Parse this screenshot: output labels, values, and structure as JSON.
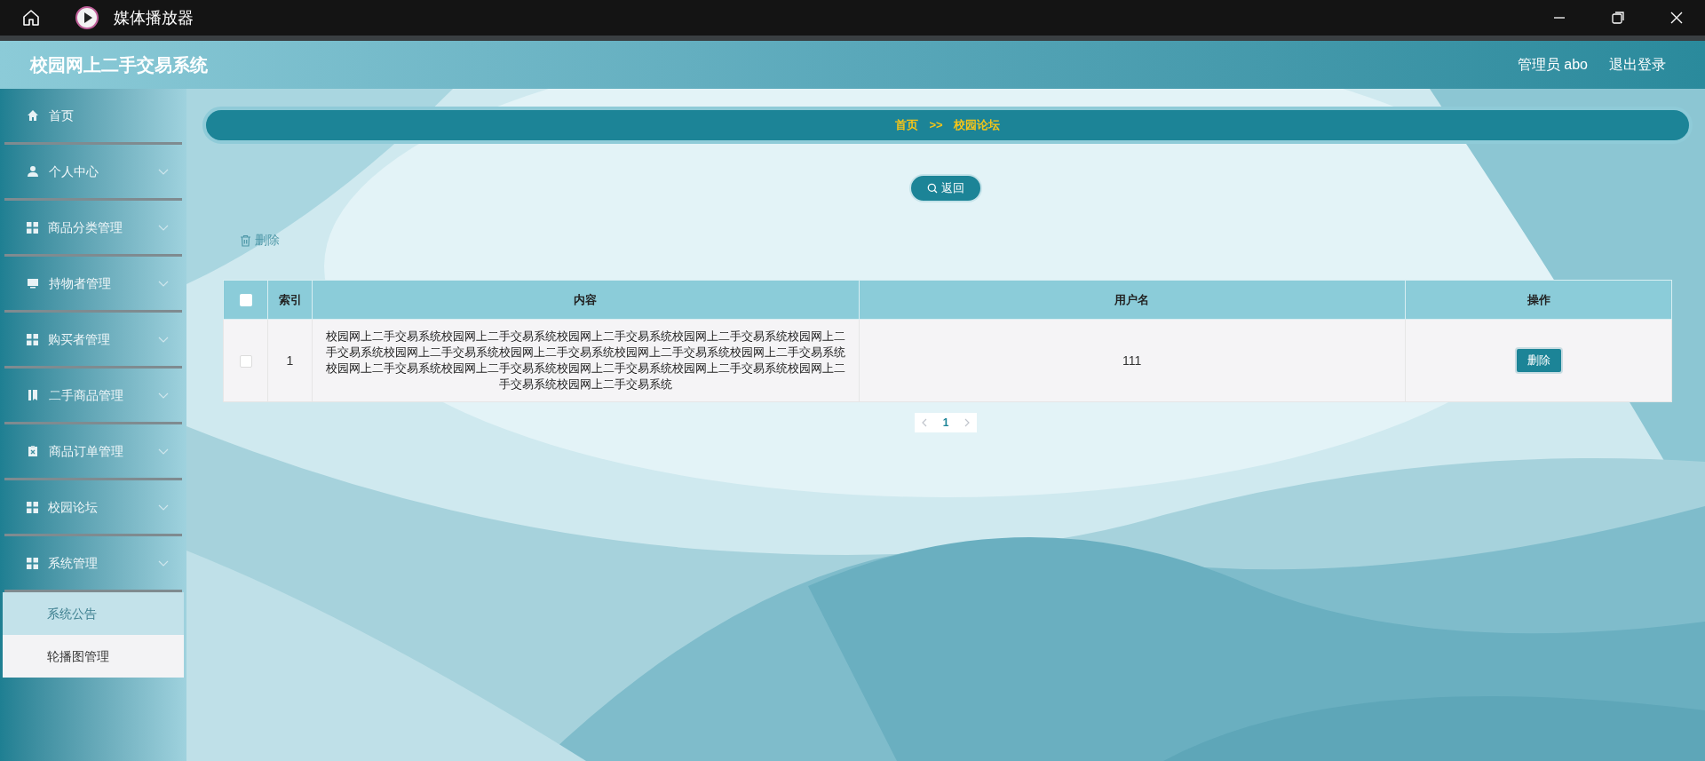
{
  "window": {
    "title": "媒体播放器"
  },
  "header": {
    "title": "校园网上二手交易系统",
    "user": "管理员 abo",
    "logout": "退出登录"
  },
  "sidebar": {
    "items": [
      {
        "label": "首页",
        "has_children": false
      },
      {
        "label": "个人中心",
        "has_children": true
      },
      {
        "label": "商品分类管理",
        "has_children": true
      },
      {
        "label": "持物者管理",
        "has_children": true
      },
      {
        "label": "购买者管理",
        "has_children": true
      },
      {
        "label": "二手商品管理",
        "has_children": true
      },
      {
        "label": "商品订单管理",
        "has_children": true
      },
      {
        "label": "校园论坛",
        "has_children": true
      },
      {
        "label": "系统管理",
        "has_children": true,
        "children": [
          {
            "label": "系统公告",
            "selected": true
          },
          {
            "label": "轮播图管理",
            "selected": false
          }
        ]
      }
    ]
  },
  "breadcrumb": {
    "home": "首页",
    "separator": ">>",
    "current": "校园论坛"
  },
  "back_button": "返回",
  "delete_link": "删除",
  "table": {
    "select_all_checked": false,
    "columns": [
      "索引",
      "内容",
      "用户名",
      "操作"
    ],
    "rows": [
      {
        "checked": false,
        "index": "1",
        "content": "校园网上二手交易系统校园网上二手交易系统校园网上二手交易系统校园网上二手交易系统校园网上二手交易系统校园网上二手交易系统校园网上二手交易系统校园网上二手交易系统校园网上二手交易系统校园网上二手交易系统校园网上二手交易系统校园网上二手交易系统校园网上二手交易系统校园网上二手交易系统校园网上二手交易系统",
        "username": "111",
        "action": "删除"
      }
    ]
  },
  "pagination": {
    "pages": [
      {
        "label": "1",
        "selected": true
      }
    ]
  }
}
